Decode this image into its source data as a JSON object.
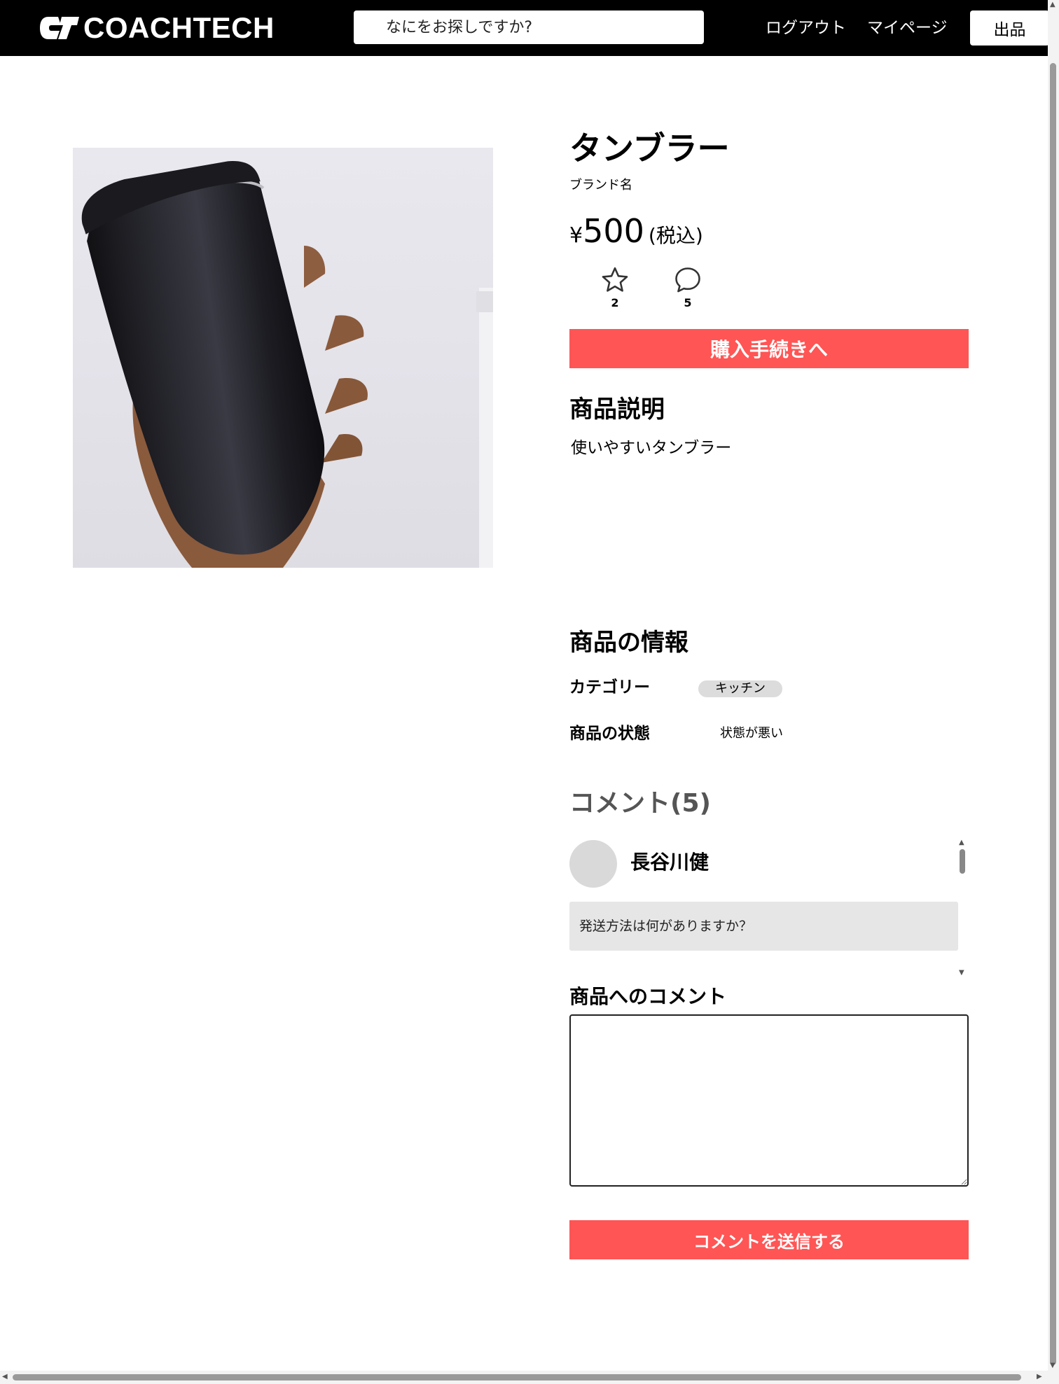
{
  "header": {
    "logo_text": "COACHTECH",
    "search_placeholder": "なにをお探しですか?",
    "logout_label": "ログアウト",
    "mypage_label": "マイページ",
    "sell_label": "出品"
  },
  "product": {
    "name": "タンブラー",
    "brand": "ブランド名",
    "currency_symbol": "¥",
    "price": "500",
    "tax_note": "(税込)",
    "likes_count": "2",
    "comments_count": "5",
    "buy_label": "購入手続きへ",
    "description_heading": "商品説明",
    "description": "使いやすいタンブラー",
    "info_heading": "商品の情報",
    "category_label": "カテゴリー",
    "category": "キッチン",
    "condition_label": "商品の状態",
    "condition": "状態が悪い"
  },
  "comments": {
    "heading": "コメント(5)",
    "items": [
      {
        "user": "長谷川健",
        "text": "発送方法は何がありますか？"
      }
    ],
    "form_label": "商品へのコメント",
    "submit_label": "コメントを送信する"
  },
  "colors": {
    "accent": "#ff5555",
    "header_bg": "#000000",
    "tag_bg": "#dcdcdc"
  }
}
